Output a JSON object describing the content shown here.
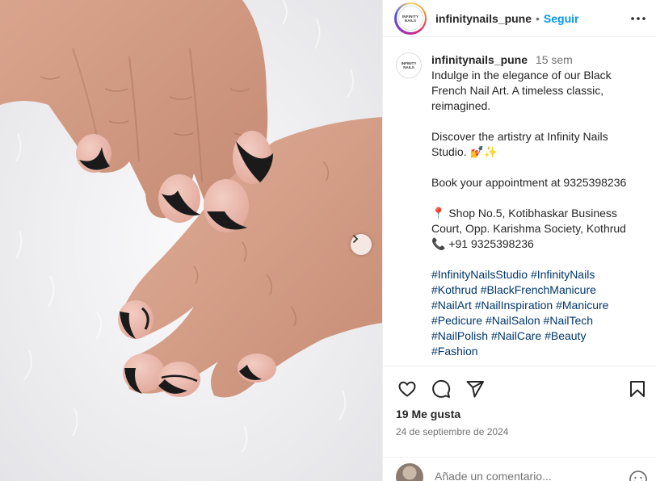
{
  "post": {
    "username": "infinitynails_pune",
    "follow_label": "Seguir",
    "separator": "•",
    "logo_text_top": "INFINITY",
    "logo_text_bottom": "NAILS"
  },
  "caption": {
    "username": "infinitynails_pune",
    "time": "15 sem",
    "lines": [
      "Indulge in the elegance of our Black",
      "French Nail Art. A timeless classic,",
      "reimagined.",
      "",
      "Discover the artistry at Infinity Nails",
      "Studio. 💅✨",
      "",
      "Book your appointment at 9325398236",
      "",
      "📍 Shop No.5, Kotibhaskar Business",
      "Court, Opp. Karishma Society, Kothrud",
      "📞 +91 9325398236"
    ],
    "hashtags": [
      [
        "#InfinityNailsStudio",
        "#InfinityNails"
      ],
      [
        "#Kothrud",
        "#BlackFrenchManicure"
      ],
      [
        "#NailArt",
        "#NailInspiration",
        "#Manicure"
      ],
      [
        "#Pedicure",
        "#NailSalon",
        "#NailTech"
      ],
      [
        "#NailPolish",
        "#NailCare",
        "#Beauty"
      ],
      [
        "#Fashion"
      ]
    ]
  },
  "engagement": {
    "likes": "19 Me gusta",
    "date": "24 de septiembre de 2024"
  },
  "comment_box": {
    "placeholder": "Añade un comentario..."
  },
  "icons": {
    "like": "heart-icon",
    "comment": "comment-icon",
    "share": "share-icon",
    "save": "bookmark-icon",
    "more": "more-options-icon",
    "next": "chevron-right-icon",
    "emoji": "emoji-icon"
  },
  "colors": {
    "follow": "#0095f6",
    "hashtag": "#00376b",
    "secondary_text": "#737373",
    "nail_tip": "#1a1a1a",
    "nail_base": "#e8b6aa"
  }
}
